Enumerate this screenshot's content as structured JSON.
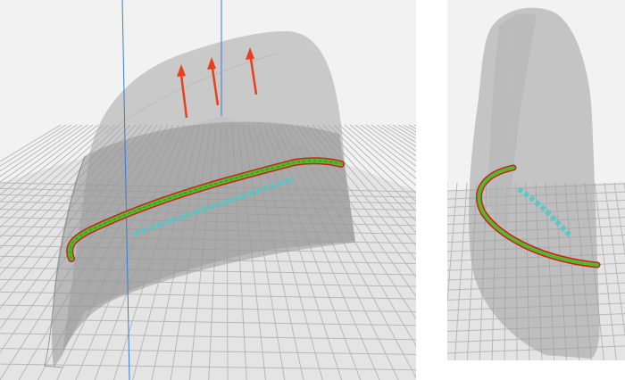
{
  "views": [
    {
      "name": "front-view",
      "arrows": 3
    },
    {
      "name": "side-view",
      "arrows": 0
    }
  ],
  "colors": {
    "background": "#f2f2f2",
    "gridLine": "#b8b8b8",
    "gridFill": "#e6e6e6",
    "shellFill": "#9a9a9a",
    "shellEdge": "#7f7f7f",
    "axis": "#3b7bd6",
    "arrow": "#e8401c",
    "bead": "#55b82a",
    "beadEdge": "#cc1f1f",
    "supportMarks": "#4fc9c9"
  },
  "icons": [
    "up-arrow-icon",
    "up-arrow-icon",
    "up-arrow-icon"
  ]
}
